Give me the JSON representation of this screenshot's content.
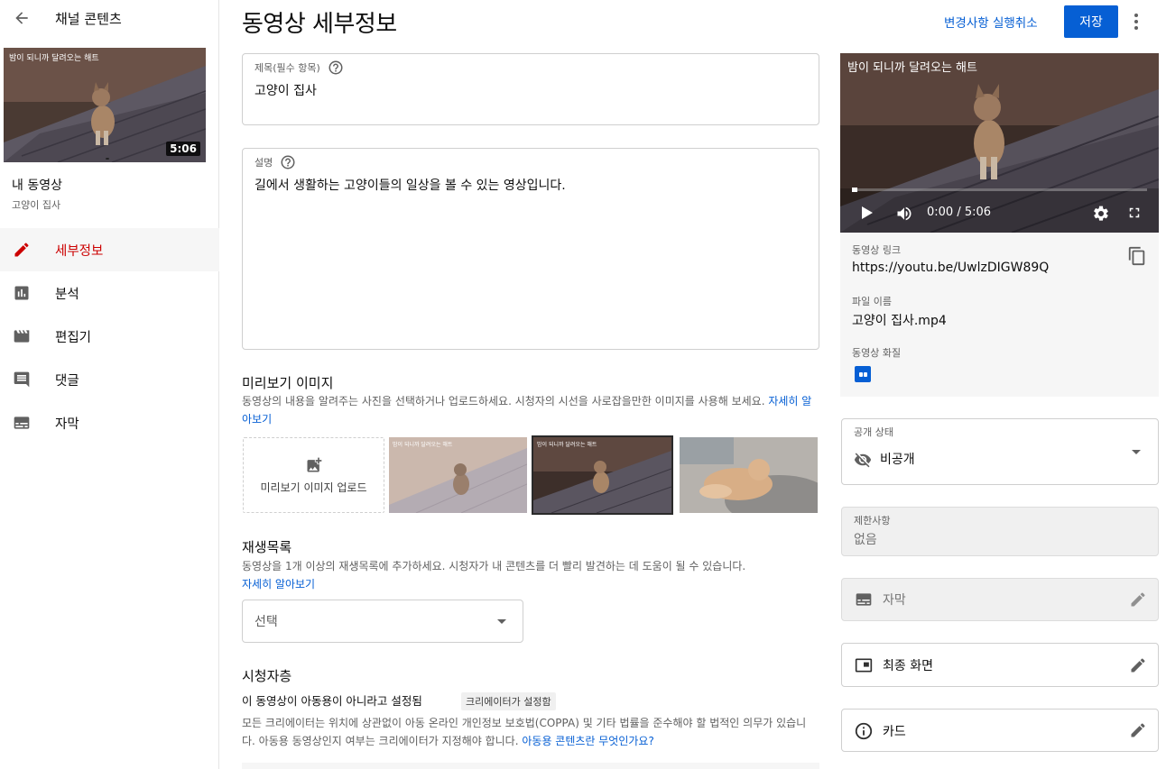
{
  "sidebar": {
    "title": "채널 콘텐츠",
    "thumb_overlay_text": "밤이 되니까 달려오는 해트",
    "duration": "5:06",
    "my_video_label": "내 동영상",
    "video_name": "고양이 집사",
    "nav": [
      {
        "label": "세부정보",
        "icon": "pencil-icon",
        "active": true
      },
      {
        "label": "분석",
        "icon": "analytics-icon",
        "active": false
      },
      {
        "label": "편집기",
        "icon": "editor-icon",
        "active": false
      },
      {
        "label": "댓글",
        "icon": "comments-icon",
        "active": false
      },
      {
        "label": "자막",
        "icon": "subtitles-icon",
        "active": false
      }
    ]
  },
  "header": {
    "title": "동영상 세부정보",
    "undo_label": "변경사항 실행취소",
    "save_label": "저장"
  },
  "form": {
    "title_label": "제목(필수 항목)",
    "title_value": "고양이 집사",
    "desc_label": "설명",
    "desc_value": "길에서 생활하는 고양이들의 일상을 볼 수 있는 영상입니다.",
    "thumbnail": {
      "heading": "미리보기 이미지",
      "description": "동영상의 내용을 알려주는 사진을 선택하거나 업로드하세요. 시청자의 시선을 사로잡을만한 이미지를 사용해 보세요.",
      "learn_more": "자세히 알아보기",
      "upload_label": "미리보기 이미지 업로드"
    },
    "playlist": {
      "heading": "재생목록",
      "description": "동영상을 1개 이상의 재생목록에 추가하세요. 시청자가 내 콘텐츠를 더 빨리 발견하는 데 도움이 될 수 있습니다.",
      "learn_more": "자세히 알아보기",
      "select_placeholder": "선택"
    },
    "audience": {
      "heading": "시청자층",
      "status": "이 동영상이 아동용이 아니라고 설정됨",
      "chip": "크리에이터가 설정함",
      "description": "모든 크리에이터는 위치에 상관없이 아동 온라인 개인정보 보호법(COPPA) 및 기타 법률을 준수해야 할 법적인 의무가 있습니다. 아동용 동영상인지 여부는 크리에이터가 지정해야 합니다.",
      "link": "아동용 콘텐츠란 무엇인가요?"
    }
  },
  "player": {
    "overlay_text": "밤이 되니까 달려오는 해트",
    "time": "0:00 / 5:06",
    "progress": 0
  },
  "info": {
    "link_label": "동영상 링크",
    "link_value": "https://youtu.be/UwlzDIGW89Q",
    "file_label": "파일 이름",
    "file_value": "고양이 집사.mp4",
    "quality_label": "동영상 화질"
  },
  "visibility": {
    "label": "공개 상태",
    "value": "비공개"
  },
  "restriction": {
    "label": "제한사항",
    "value": "없음"
  },
  "subtitles_box": {
    "label": "자막"
  },
  "endscreen_box": {
    "label": "최종 화면"
  },
  "cards_box": {
    "label": "카드"
  },
  "colors": {
    "accent": "#065fd4",
    "active_nav": "#cc0000"
  }
}
